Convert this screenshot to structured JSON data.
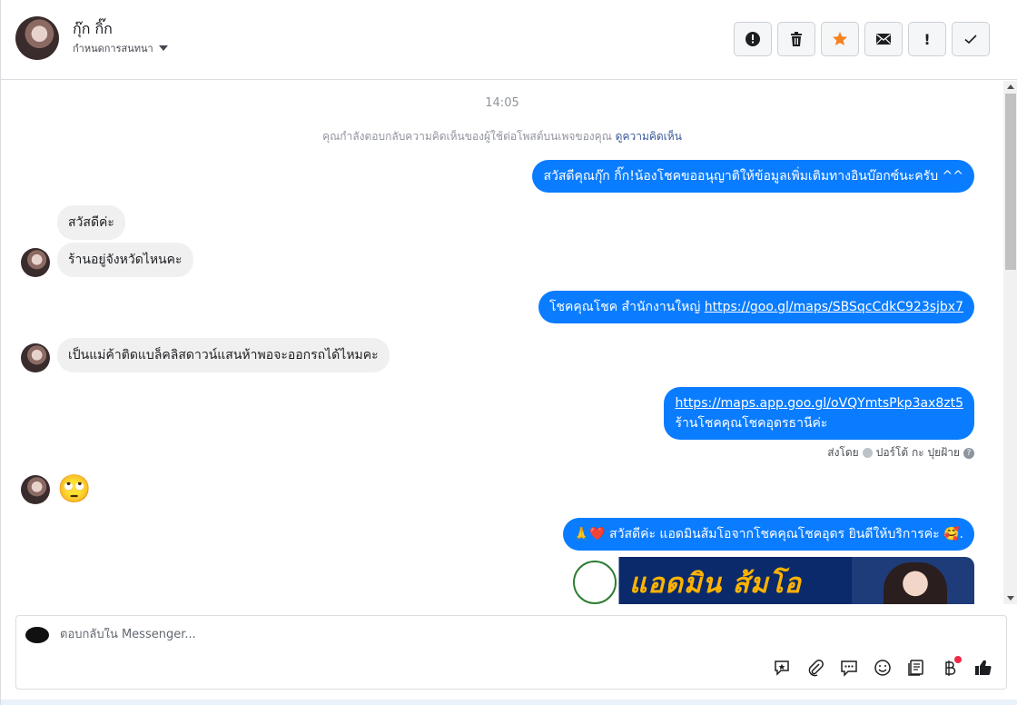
{
  "header": {
    "contact_name": "กุ๊ก กิ๊ก",
    "assign_label": "กำหนดการสนทนา",
    "actions": [
      {
        "name": "spam-button",
        "icon": "alert-circle-icon",
        "glyph": "!"
      },
      {
        "name": "delete-button",
        "icon": "trash-icon",
        "glyph": ""
      },
      {
        "name": "star-button",
        "icon": "star-icon",
        "glyph": "★"
      },
      {
        "name": "mark-unread-button",
        "icon": "envelope-icon",
        "glyph": ""
      },
      {
        "name": "follow-up-button",
        "icon": "exclamation-icon",
        "glyph": "!"
      },
      {
        "name": "mark-done-button",
        "icon": "check-icon",
        "glyph": "✓"
      }
    ]
  },
  "conversation": {
    "timestamp": "14:05",
    "notice_text": "คุณกำลังตอบกลับความคิดเห็นของผู้ใช้ต่อโพสต์บนเพจของคุณ",
    "notice_link": "ดูความคิดเห็น",
    "messages": [
      {
        "direction": "out",
        "text": "สวัสดีคุณกุ๊ก กิ๊ก!น้องโชคขออนุญาติให้ข้อมูลเพิ่มเติมทางอินบ๊อกซ์นะครับ ^^"
      },
      {
        "direction": "in",
        "text": "สวัสดีค่ะ"
      },
      {
        "direction": "in",
        "text": "ร้านอยู่จังหวัดไหนคะ"
      },
      {
        "direction": "out",
        "text": "โชคคุณโชค สำนักงานใหญ่ ",
        "link": "https://goo.gl/maps/SBSqcCdkC923sjbx7"
      },
      {
        "direction": "in",
        "text": "เป็นแม่ค้าติดแบล็คลิสดาวน์แสนห้าพอจะออกรถได้ไหมคะ"
      },
      {
        "direction": "out",
        "link": "https://maps.app.goo.gl/oVQYmtsPkp3ax8zt5",
        "text": "ร้านโชคคุณโชคอุดรธานีค่ะ"
      },
      {
        "direction": "in",
        "emoji": "🙄"
      },
      {
        "direction": "out",
        "text": "🙏❤️ สวัสดีค่ะ แอดมินส้มโอจากโชคคุณโชคอุดร ยินดีให้บริการค่ะ 🥰."
      }
    ],
    "sent_by_prefix": "ส่งโดย",
    "sent_by_name": "ปอร์โต้ กะ ปุยฝ้าย",
    "banner_text": "แอดมิน ส้มโอ"
  },
  "composer": {
    "placeholder": "ตอบกลับใน Messenger...",
    "tools": [
      "saved-reply-icon",
      "attachment-icon",
      "chat-icon",
      "emoji-icon",
      "book-icon",
      "baht-icon",
      "thumbs-up-icon"
    ]
  },
  "colors": {
    "outgoing": "#0a7cff",
    "incoming": "#f0f0f0",
    "accent_star": "#f5821f"
  }
}
